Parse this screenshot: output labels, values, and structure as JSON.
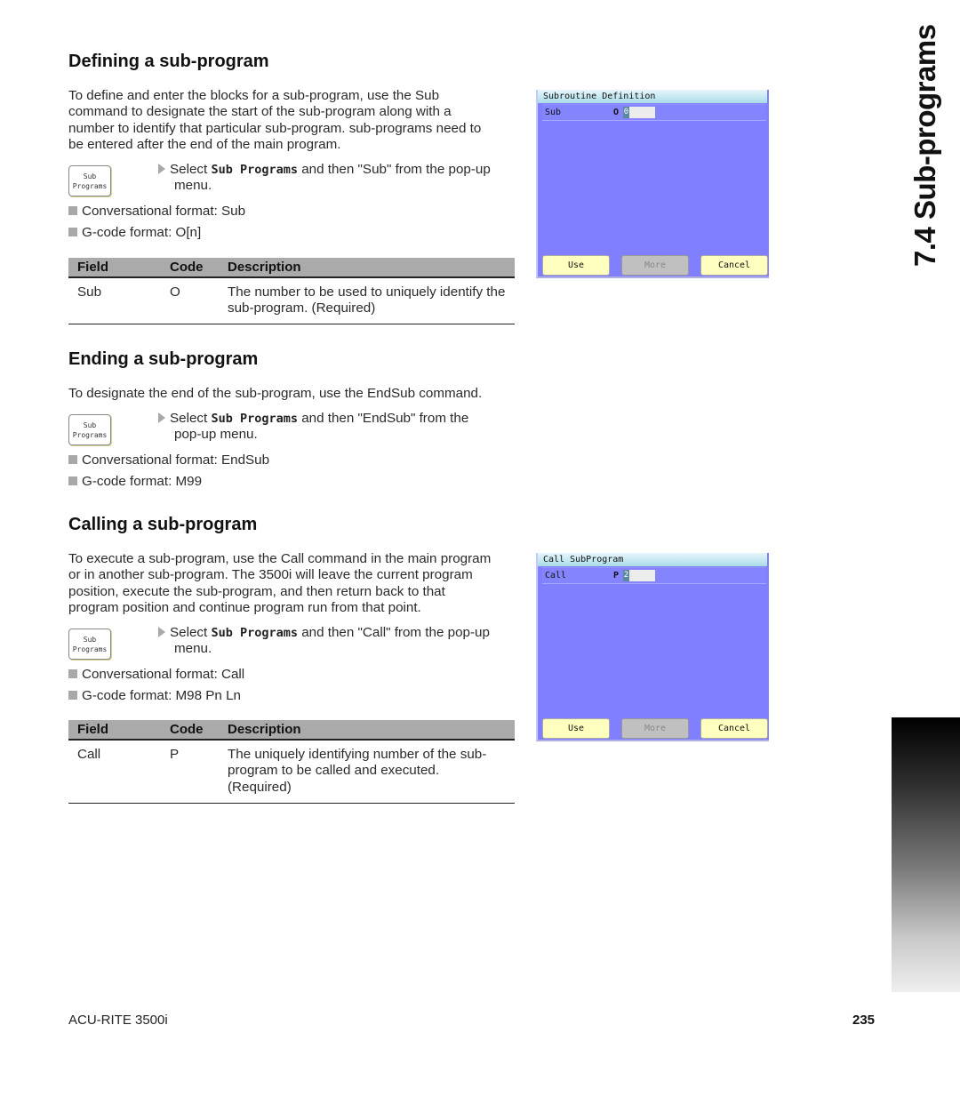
{
  "side_title": "7.4 Sub-programs",
  "footer": {
    "product": "ACU-RITE 3500i",
    "page_number": "235"
  },
  "softkey": {
    "line1": "Sub",
    "line2": "Programs"
  },
  "icons": {
    "step_arrow": "triangle-right",
    "bullet": "square"
  },
  "colors": {
    "screen_bg": "#7f7fff",
    "button_bg": "#ffffc0",
    "button_disabled_bg": "#c0c0c0",
    "table_header_bg": "#aaaaaa"
  },
  "sections": {
    "defining": {
      "heading": "Defining a sub-program",
      "intro": [
        "To define and enter the blocks for a sub-program, use the Sub",
        "command to designate the start of the sub-program along with a",
        "number to identify that particular sub-program. sub-programs need to",
        "be entered after the end of the main program."
      ],
      "step": {
        "pre": "Select ",
        "key": "Sub Programs",
        "post": " and then \"Sub\" from the pop-up",
        "cont": "menu."
      },
      "bullets": [
        "Conversational format: Sub",
        "G-code format: O[n]"
      ],
      "table": {
        "headers": [
          "Field",
          "Code",
          "Description"
        ],
        "rows": [
          {
            "field": "Sub",
            "code": "O",
            "description": "The number to be used to uniquely identify the sub-program. (Required)"
          }
        ]
      },
      "screen": {
        "title": "Subroutine Definition",
        "field_label": "Sub",
        "field_code": "O",
        "field_value": "0",
        "buttons": [
          {
            "label": "Use",
            "enabled": true
          },
          {
            "label": "More",
            "enabled": false
          },
          {
            "label": "Cancel",
            "enabled": true
          }
        ]
      }
    },
    "ending": {
      "heading": "Ending a sub-program",
      "intro": [
        "To designate the end of the sub-program, use the EndSub command."
      ],
      "step": {
        "pre": "Select ",
        "key": "Sub Programs",
        "post": " and then \"EndSub\" from the",
        "cont": "pop-up menu."
      },
      "bullets": [
        "Conversational format: EndSub",
        "G-code format: M99"
      ]
    },
    "calling": {
      "heading": "Calling a sub-program",
      "intro": [
        "To execute a sub-program, use the Call command in the main program",
        "or in another sub-program. The 3500i will leave the current program",
        "position, execute the sub-program, and then return back to that",
        "program position and continue program run from that point."
      ],
      "step": {
        "pre": "Select ",
        "key": "Sub Programs",
        "post": " and then \"Call\" from the pop-up",
        "cont": "menu."
      },
      "bullets": [
        "Conversational format: Call",
        "G-code format: M98 Pn Ln"
      ],
      "table": {
        "headers": [
          "Field",
          "Code",
          "Description"
        ],
        "rows": [
          {
            "field": "Call",
            "code": "P",
            "description": "The uniquely identifying number of the sub-program to be called and executed. (Required)"
          }
        ]
      },
      "screen": {
        "title": "Call SubProgram",
        "field_label": "Call",
        "field_code": "P",
        "field_value": "2",
        "buttons": [
          {
            "label": "Use",
            "enabled": true
          },
          {
            "label": "More",
            "enabled": false
          },
          {
            "label": "Cancel",
            "enabled": true
          }
        ]
      }
    }
  }
}
